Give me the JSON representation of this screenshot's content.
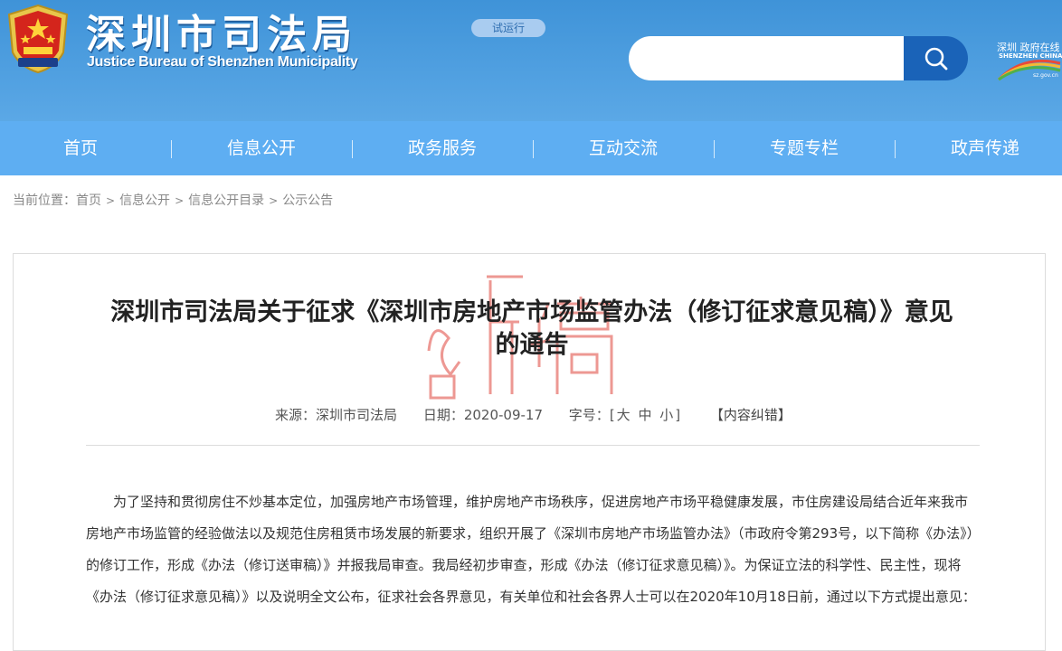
{
  "header": {
    "title": "深圳市司法局",
    "subtitle": "Justice Bureau of Shenzhen Municipality",
    "trial_badge": "试运行",
    "search": {
      "value": "",
      "placeholder": ""
    },
    "emblem_icon": "police-emblem",
    "search_icon": "magnifier",
    "city_logo": {
      "cn": "深圳 政府在线",
      "en": "SHENZHEN CHINA",
      "domain": "sz.gov.cn"
    }
  },
  "nav": [
    {
      "label": "首页"
    },
    {
      "label": "信息公开"
    },
    {
      "label": "政务服务"
    },
    {
      "label": "互动交流"
    },
    {
      "label": "专题专栏"
    },
    {
      "label": "政声传递"
    }
  ],
  "breadcrumb": {
    "prefix": "当前位置：",
    "items": [
      "首页",
      "信息公开",
      "信息公开目录",
      "公示公告"
    ],
    "separator": ">"
  },
  "article": {
    "title": "深圳市司法局关于征求《深圳市房地产市场监管办法（修订征求意见稿）》意见的通告",
    "meta": {
      "source_label": "来源：",
      "source": "深圳市司法局",
      "date_label": "日期：",
      "date": "2020-09-17",
      "fontsize_label": "字号：",
      "size_open": "[",
      "size_large": "大",
      "size_medium": "中",
      "size_small": "小",
      "size_close": "]",
      "correction": "【内容纠错】"
    },
    "paragraphs": [
      "为了坚持和贯彻房住不炒基本定位，加强房地产市场管理，维护房地产市场秩序，促进房地产市场平稳健康发展，市住房建设局结合近年来我市房地产市场监管的经验做法以及规范住房租赁市场发展的新要求，组织开展了《深圳市房地产市场监管办法》（市政府令第293号，以下简称《办法》）的修订工作，形成《办法（修订送审稿）》并报我局审查。我局经初步审查，形成《办法（修订征求意见稿）》。为保证立法的科学性、民主性，现将《办法（修订征求意见稿）》以及说明全文公布，征求社会各界意见，有关单位和社会各界人士可以在2020年10月18日前，通过以下方式提出意见："
    ]
  },
  "watermark": {
    "text": "i新稿",
    "color": "#e0443c"
  },
  "colors": {
    "header_bg": "#4a9de0",
    "nav_bg": "#5eaef2",
    "search_button": "#1a63b8",
    "text_primary": "#222222",
    "text_muted": "#888888"
  }
}
